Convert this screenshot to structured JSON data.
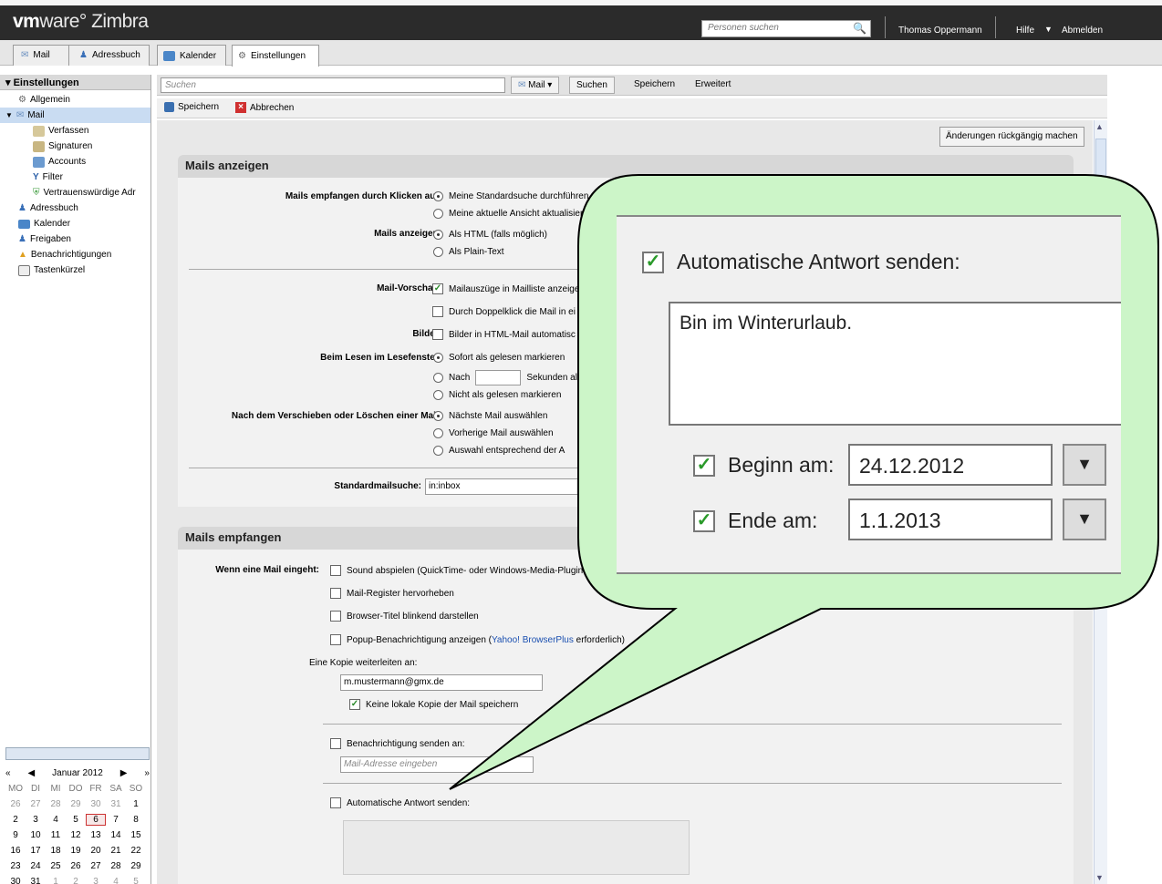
{
  "topbar": {
    "logo_vm": "vm",
    "logo_ware": "ware° Zimbra",
    "people_search_placeholder": "Personen suchen",
    "user": "Thomas Oppermann",
    "help": "Hilfe",
    "logout": "Abmelden"
  },
  "apptabs": [
    {
      "label": "Mail",
      "icon": "envelope-icon"
    },
    {
      "label": "Adressbuch",
      "icon": "contact-icon"
    },
    {
      "label": "Kalender",
      "icon": "calendar-icon"
    },
    {
      "label": "Einstellungen",
      "icon": "gear-icon"
    }
  ],
  "left": {
    "header": "Einstellungen",
    "items": [
      {
        "label": "Allgemein",
        "icon": "gear-icon"
      },
      {
        "label": "Mail",
        "icon": "envelope-icon"
      },
      {
        "label": "Verfassen",
        "icon": "compose-icon"
      },
      {
        "label": "Signaturen",
        "icon": "signature-icon"
      },
      {
        "label": "Accounts",
        "icon": "accounts-icon"
      },
      {
        "label": "Filter",
        "icon": "filter-icon"
      },
      {
        "label": "Vertrauenswürdige Adr",
        "icon": "shield-icon"
      },
      {
        "label": "Adressbuch",
        "icon": "contact-icon"
      },
      {
        "label": "Kalender",
        "icon": "calendar-icon"
      },
      {
        "label": "Freigaben",
        "icon": "share-icon"
      },
      {
        "label": "Benachrichtigungen",
        "icon": "bell-icon"
      },
      {
        "label": "Tastenkürzel",
        "icon": "keyboard-icon"
      }
    ]
  },
  "calendar": {
    "month": "Januar 2012",
    "weekdays": [
      "MO",
      "DI",
      "MI",
      "DO",
      "FR",
      "SA",
      "SO"
    ],
    "weeks": [
      [
        "26",
        "27",
        "28",
        "29",
        "30",
        "31",
        "1"
      ],
      [
        "2",
        "3",
        "4",
        "5",
        "6",
        "7",
        "8"
      ],
      [
        "9",
        "10",
        "11",
        "12",
        "13",
        "14",
        "15"
      ],
      [
        "16",
        "17",
        "18",
        "19",
        "20",
        "21",
        "22"
      ],
      [
        "23",
        "24",
        "25",
        "26",
        "27",
        "28",
        "29"
      ],
      [
        "30",
        "31",
        "1",
        "2",
        "3",
        "4",
        "5"
      ]
    ],
    "today": "6"
  },
  "searchbar": {
    "placeholder": "Suchen",
    "scope": "Mail",
    "search": "Suchen",
    "save": "Speichern",
    "advanced": "Erweitert"
  },
  "actions": {
    "save": "Speichern",
    "cancel": "Abbrechen"
  },
  "revert": "Änderungen rückgängig machen",
  "display": {
    "title": "Mails anzeigen",
    "click_label": "Mails empfangen durch Klicken auf:",
    "click_opt1": "Meine Standardsuche durchführen",
    "click_opt2": "Meine aktuelle Ansicht aktualisieren",
    "show_label": "Mails anzeigen:",
    "show_opt1": "Als HTML (falls möglich)",
    "show_opt2": "Als Plain-Text",
    "preview_label": "Mail-Vorschau:",
    "preview_opt1": "Mailauszüge in Mailliste anzeigen",
    "preview_opt2": "Durch Doppelklick die Mail in ei",
    "images_label": "Bilder:",
    "images_opt": "Bilder in HTML-Mail automatisc",
    "read_label": "Beim Lesen im Lesefenster:",
    "read_opt1": "Sofort als gelesen markieren",
    "read_opt2_pre": "Nach",
    "read_opt2_post": "Sekunden al",
    "read_opt3": "Nicht als gelesen markieren",
    "move_label": "Nach dem Verschieben oder Löschen einer Mail:",
    "move_opt1": "Nächste Mail auswählen",
    "move_opt2": "Vorherige Mail auswählen",
    "move_opt3": "Auswahl entsprechend der A",
    "default_search_label": "Standardmailsuche:",
    "default_search_value": "in:inbox"
  },
  "receive": {
    "title": "Mails empfangen",
    "new_mail_label": "Wenn eine Mail eingeht:",
    "sound": "Sound abspielen (QuickTime- oder Windows-Media-Plugin",
    "highlight": "Mail-Register hervorheben",
    "blink": "Browser-Titel blinkend darstellen",
    "popup_pre": "Popup-Benachrichtigung anzeigen (",
    "popup_link": "Yahoo! BrowserPlus",
    "popup_post": " erforderlich)",
    "forward_label": "Eine Kopie weiterleiten an:",
    "forward_value": "m.mustermann@gmx.de",
    "no_local_copy": "Keine lokale Kopie der Mail speichern",
    "notify": "Benachrichtigung senden an:",
    "notify_placeholder": "Mail-Adresse eingeben",
    "auto_reply": "Automatische Antwort senden:"
  },
  "zoom": {
    "auto_reply": "Automatische Antwort senden:",
    "message": "Bin im Winterurlaub.",
    "start_label": "Beginn am:",
    "start_value": "24.12.2012",
    "end_label": "Ende am:",
    "end_value": "1.1.2013"
  },
  "colors": {
    "callout_fill": "#ccf5c8",
    "topbar": "#2b2b2b",
    "selected": "#c9dcf2"
  }
}
